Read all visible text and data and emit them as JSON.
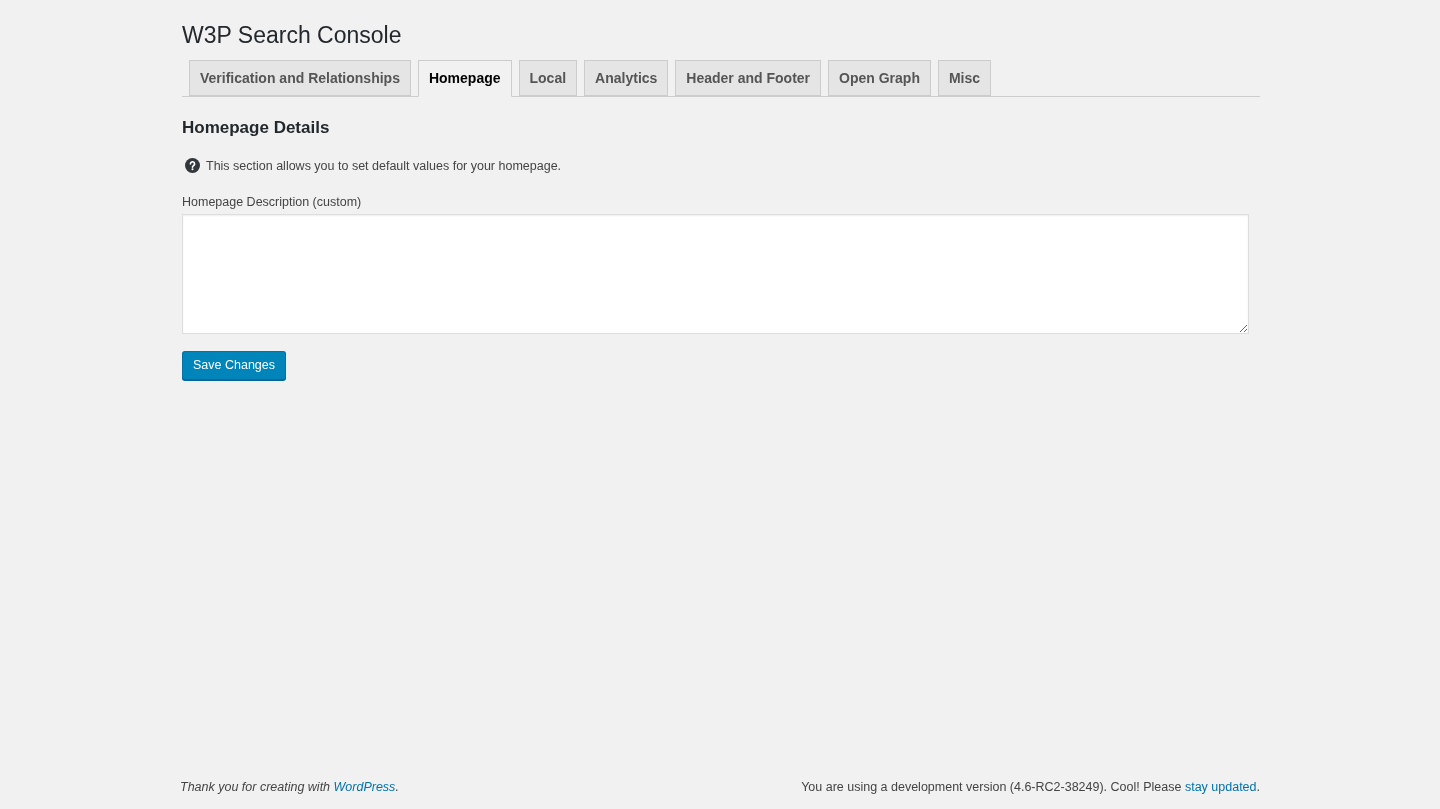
{
  "title": "W3P Search Console",
  "tabs": [
    {
      "label": "Verification and Relationships",
      "selected": false
    },
    {
      "label": "Homepage",
      "selected": true
    },
    {
      "label": "Local",
      "selected": false
    },
    {
      "label": "Analytics",
      "selected": false
    },
    {
      "label": "Header and Footer",
      "selected": false
    },
    {
      "label": "Open Graph",
      "selected": false
    },
    {
      "label": "Misc",
      "selected": false
    }
  ],
  "section": {
    "heading": "Homepage Details",
    "help": "This section allows you to set default values for your homepage.",
    "field_label": "Homepage Description (custom)"
  },
  "save_button": "Save Changes",
  "footer": {
    "left": {
      "before": "Thank you for creating with ",
      "link": "WordPress",
      "after": "."
    },
    "right": {
      "before": "You are using a development version (4.6-RC2-38249). Cool! Please ",
      "link": "stay updated",
      "after": "."
    }
  }
}
